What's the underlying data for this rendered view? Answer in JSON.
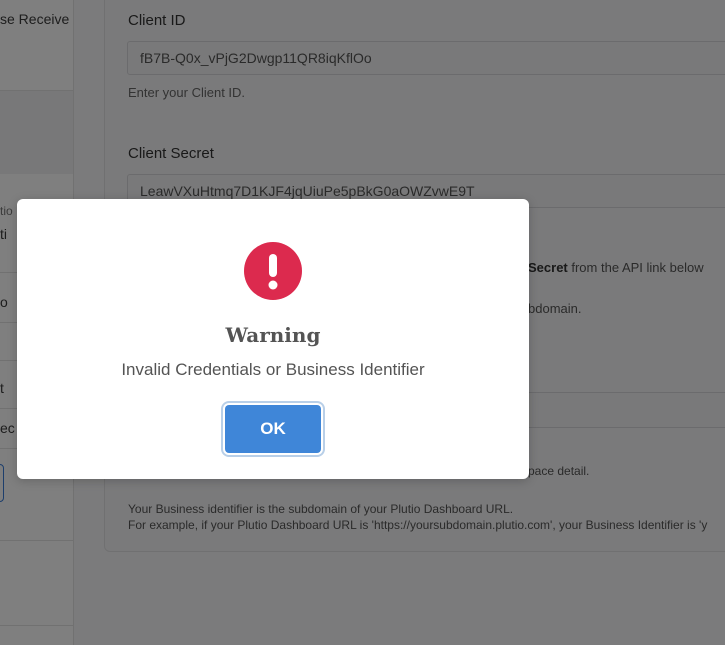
{
  "sidebar": {
    "fragments": [
      {
        "text": "se Receive"
      },
      {
        "text": "tio"
      },
      {
        "text": "ti"
      },
      {
        "text": "o"
      },
      {
        "text": "t"
      },
      {
        "text": "ec"
      }
    ]
  },
  "form": {
    "client_id": {
      "label": "Client ID",
      "value": "fB7B-Q0x_vPjG2Dwgp11QR8iqKflOo",
      "help": "Enter your Client ID."
    },
    "client_secret": {
      "label": "Client Secret",
      "value": "LeawVXuHtmq7D1KJF4jqUiuPe5pBkG0aOWZvwE9T"
    },
    "partial_secret_help_bold": "Secret",
    "partial_secret_help_rest": " from the API link below",
    "partial_subdomain": "bdomain.",
    "partial_workspace": "pace detail.",
    "business_identifier_help_1": "Your Business identifier is the subdomain of your Plutio Dashboard URL.",
    "business_identifier_help_2": "For example, if your Plutio Dashboard URL is 'https://yoursubdomain.plutio.com', your Business Identifier is 'y"
  },
  "modal": {
    "icon": "exclamation-circle-icon",
    "icon_color": "#dc2a4e",
    "title": "Warning",
    "message": "Invalid Credentials or Business Identifier",
    "ok_label": "OK",
    "ok_color": "#3f86d8"
  }
}
